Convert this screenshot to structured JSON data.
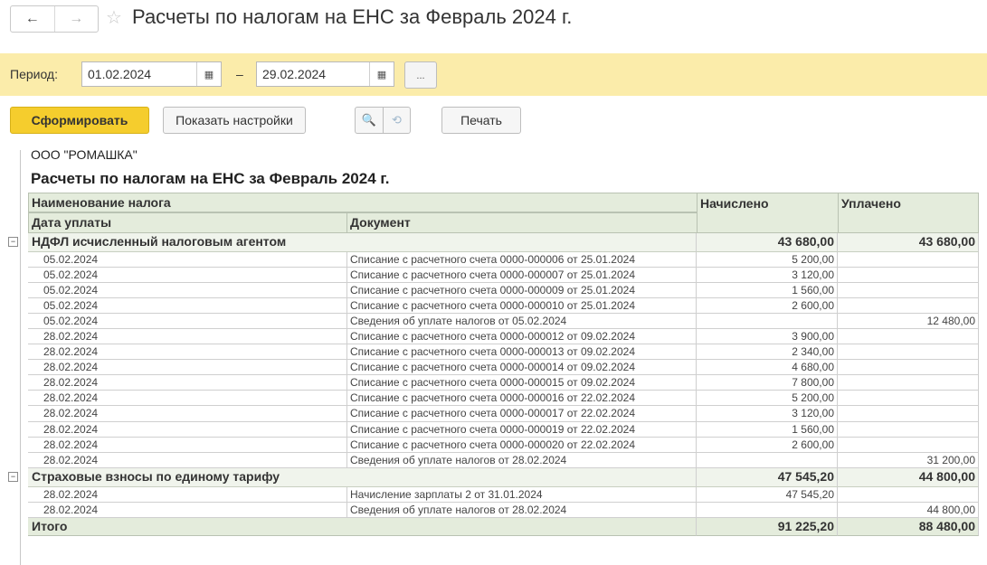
{
  "nav": {
    "back_icon": "←",
    "forward_icon": "→",
    "star_icon": "☆"
  },
  "window": {
    "title": "Расчеты по налогам на ЕНС за Февраль 2024 г."
  },
  "period": {
    "label": "Период:",
    "from": "01.02.2024",
    "to": "29.02.2024",
    "separator": "–",
    "more": "...",
    "calendar_icon": "▦"
  },
  "toolbar": {
    "generate": "Сформировать",
    "show_settings": "Показать настройки",
    "search_icon": "🔍",
    "search_clear_icon": "⟲",
    "print": "Печать"
  },
  "report": {
    "company": "ООО \"РОМАШКА\"",
    "title": "Расчеты по налогам на ЕНС за Февраль 2024 г.",
    "headers": {
      "tax_name": "Наименование налога",
      "pay_date": "Дата уплаты",
      "document": "Документ",
      "accrued": "Начислено",
      "paid": "Уплачено"
    },
    "groups": [
      {
        "name": "НДФЛ исчисленный налоговым агентом",
        "accrued": "43 680,00",
        "paid": "43 680,00",
        "rows": [
          {
            "date": "05.02.2024",
            "doc": "Списание с расчетного счета 0000-000006 от 25.01.2024",
            "accrued": "5 200,00",
            "paid": ""
          },
          {
            "date": "05.02.2024",
            "doc": "Списание с расчетного счета 0000-000007 от 25.01.2024",
            "accrued": "3 120,00",
            "paid": ""
          },
          {
            "date": "05.02.2024",
            "doc": "Списание с расчетного счета 0000-000009 от 25.01.2024",
            "accrued": "1 560,00",
            "paid": ""
          },
          {
            "date": "05.02.2024",
            "doc": "Списание с расчетного счета 0000-000010 от 25.01.2024",
            "accrued": "2 600,00",
            "paid": ""
          },
          {
            "date": "05.02.2024",
            "doc": "Сведения об уплате налогов от 05.02.2024",
            "accrued": "",
            "paid": "12 480,00"
          },
          {
            "date": "28.02.2024",
            "doc": "Списание с расчетного счета 0000-000012 от 09.02.2024",
            "accrued": "3 900,00",
            "paid": ""
          },
          {
            "date": "28.02.2024",
            "doc": "Списание с расчетного счета 0000-000013 от 09.02.2024",
            "accrued": "2 340,00",
            "paid": ""
          },
          {
            "date": "28.02.2024",
            "doc": "Списание с расчетного счета 0000-000014 от 09.02.2024",
            "accrued": "4 680,00",
            "paid": ""
          },
          {
            "date": "28.02.2024",
            "doc": "Списание с расчетного счета 0000-000015 от 09.02.2024",
            "accrued": "7 800,00",
            "paid": ""
          },
          {
            "date": "28.02.2024",
            "doc": "Списание с расчетного счета 0000-000016 от 22.02.2024",
            "accrued": "5 200,00",
            "paid": ""
          },
          {
            "date": "28.02.2024",
            "doc": "Списание с расчетного счета 0000-000017 от 22.02.2024",
            "accrued": "3 120,00",
            "paid": ""
          },
          {
            "date": "28.02.2024",
            "doc": "Списание с расчетного счета 0000-000019 от 22.02.2024",
            "accrued": "1 560,00",
            "paid": ""
          },
          {
            "date": "28.02.2024",
            "doc": "Списание с расчетного счета 0000-000020 от 22.02.2024",
            "accrued": "2 600,00",
            "paid": ""
          },
          {
            "date": "28.02.2024",
            "doc": "Сведения об уплате налогов от 28.02.2024",
            "accrued": "",
            "paid": "31 200,00"
          }
        ]
      },
      {
        "name": "Страховые взносы по единому тарифу",
        "accrued": "47 545,20",
        "paid": "44 800,00",
        "rows": [
          {
            "date": "28.02.2024",
            "doc": "Начисление зарплаты 2 от 31.01.2024",
            "accrued": "47 545,20",
            "paid": ""
          },
          {
            "date": "28.02.2024",
            "doc": "Сведения об уплате налогов от 28.02.2024",
            "accrued": "",
            "paid": "44 800,00"
          }
        ]
      }
    ],
    "total": {
      "label": "Итого",
      "accrued": "91 225,20",
      "paid": "88 480,00"
    },
    "toggle_icon": "−"
  }
}
